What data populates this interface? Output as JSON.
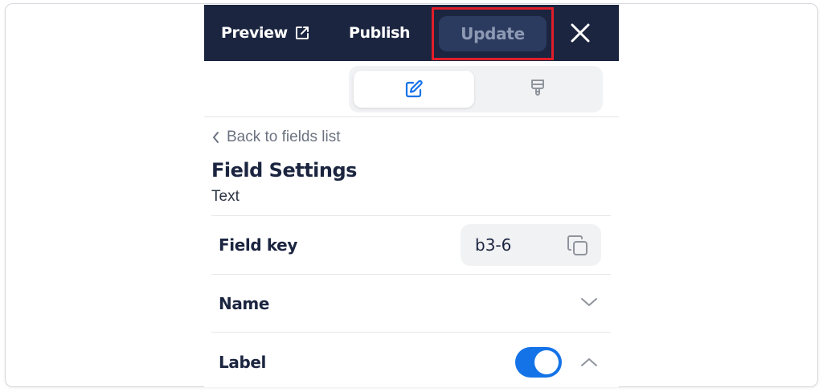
{
  "topbar": {
    "preview_label": "Preview",
    "publish_label": "Publish",
    "update_label": "Update"
  },
  "nav": {
    "back_label": "Back to fields list"
  },
  "settings": {
    "title": "Field Settings",
    "subtitle": "Text"
  },
  "rows": {
    "field_key_label": "Field key",
    "field_key_value": "b3-6",
    "name_label": "Name",
    "label_label": "Label",
    "label_toggle_on": true
  },
  "colors": {
    "topbar_bg": "#1b2540",
    "highlight": "#e01e2a",
    "toggle_on": "#1573e8",
    "accent_icon": "#1573e8"
  },
  "icons": {
    "preview": "external-link-icon",
    "close": "close-icon",
    "edit_mode": "pencil-edit-icon",
    "style_mode": "paint-brush-icon",
    "back": "chevron-left-icon",
    "copy": "copy-icon",
    "name_toggle": "chevron-down-icon",
    "label_toggle": "chevron-up-icon"
  }
}
